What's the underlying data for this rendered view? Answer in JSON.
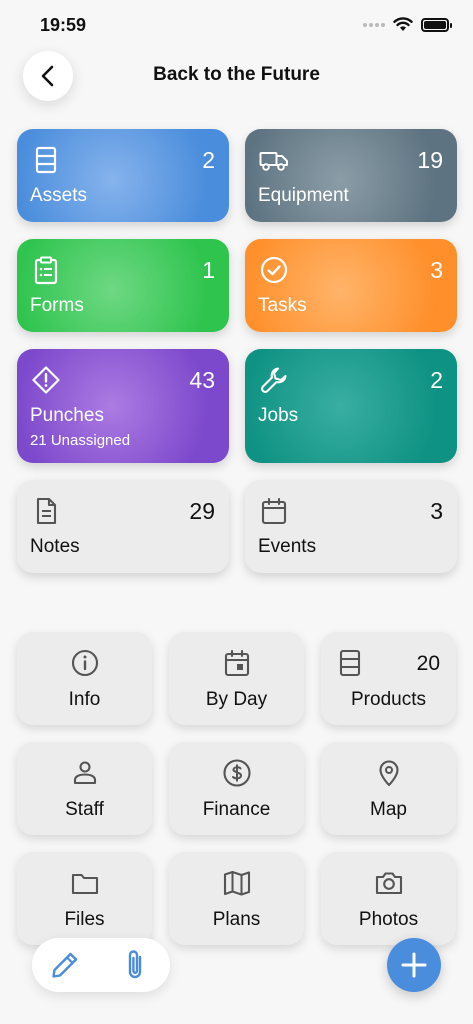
{
  "status_bar": {
    "time": "19:59"
  },
  "header": {
    "title": "Back to the Future"
  },
  "big_tiles": {
    "assets": {
      "label": "Assets",
      "count": "2"
    },
    "equipment": {
      "label": "Equipment",
      "count": "19"
    },
    "forms": {
      "label": "Forms",
      "count": "1"
    },
    "tasks": {
      "label": "Tasks",
      "count": "3"
    },
    "punches": {
      "label": "Punches",
      "count": "43",
      "sub": "21 Unassigned"
    },
    "jobs": {
      "label": "Jobs",
      "count": "2"
    },
    "notes": {
      "label": "Notes",
      "count": "29"
    },
    "events": {
      "label": "Events",
      "count": "3"
    }
  },
  "small_tiles": {
    "info": {
      "label": "Info"
    },
    "by_day": {
      "label": "By Day"
    },
    "products": {
      "label": "Products",
      "count": "20"
    },
    "staff": {
      "label": "Staff"
    },
    "finance": {
      "label": "Finance"
    },
    "map": {
      "label": "Map"
    },
    "files": {
      "label": "Files"
    },
    "plans": {
      "label": "Plans"
    },
    "photos": {
      "label": "Photos"
    }
  },
  "colors": {
    "assets": "#4a8ddc",
    "equipment": "#5e7381",
    "forms": "#2fc44e",
    "tasks": "#ff8f2a",
    "punches": "#7c48cc",
    "jobs": "#0e9283",
    "accent": "#4a8ddc"
  },
  "icons": {
    "assets": "storage-list-icon",
    "equipment": "truck-icon",
    "forms": "clipboard-list-icon",
    "tasks": "check-circle-icon",
    "punches": "warning-diamond-icon",
    "jobs": "wrench-icon",
    "notes": "document-icon",
    "events": "calendar-icon",
    "info": "info-icon",
    "by_day": "calendar-day-icon",
    "products": "storage-list-icon",
    "staff": "person-icon",
    "finance": "dollar-circle-icon",
    "map": "map-pin-icon",
    "files": "folder-icon",
    "plans": "map-icon",
    "photos": "camera-icon",
    "edit": "pencil-icon",
    "attach": "paperclip-icon",
    "add": "plus-icon",
    "back": "chevron-left-icon"
  }
}
